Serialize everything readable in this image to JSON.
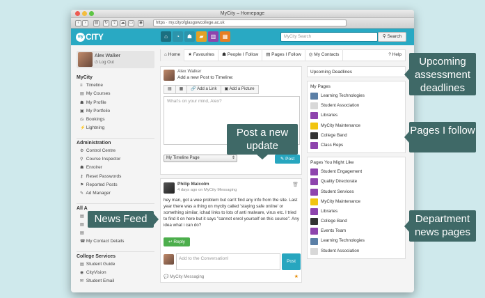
{
  "browser": {
    "title": "MyCity – Homepage",
    "url": "https · my.cityofglasgowcollege.ac.uk"
  },
  "nav": {
    "logo_prefix": "my",
    "logo_text": "CITY",
    "search_placeholder": "MyCity Search",
    "search_button": "Search",
    "icons": [
      {
        "name": "home-icon",
        "glyph": "⌂",
        "color": "#1b6f80"
      },
      {
        "name": "dashboard-icon",
        "glyph": "◔",
        "color": "#2c94ab"
      },
      {
        "name": "users-icon",
        "glyph": "☗",
        "color": "#2c94ab"
      },
      {
        "name": "folder-icon",
        "glyph": "▰",
        "color": "#e4a124"
      },
      {
        "name": "chart-icon",
        "glyph": "▥",
        "color": "#8e44ad"
      },
      {
        "name": "calendar-icon",
        "glyph": "▦",
        "color": "#e67e22"
      }
    ]
  },
  "user": {
    "name": "Alex Walker",
    "logout": "Log Out"
  },
  "sidebar": {
    "sections": [
      {
        "title": "MyCity",
        "items": [
          {
            "label": "Timeline",
            "icon": "≡"
          },
          {
            "label": "My Courses",
            "icon": "▤"
          },
          {
            "label": "My Profile",
            "icon": "☗"
          },
          {
            "label": "My Portfolio",
            "icon": "▣"
          },
          {
            "label": "Bookings",
            "icon": "◷"
          },
          {
            "label": "Lightning",
            "icon": "⚡"
          }
        ]
      },
      {
        "title": "Administration",
        "items": [
          {
            "label": "Control Centre",
            "icon": "⚙"
          },
          {
            "label": "Course Inspector",
            "icon": "⚲"
          },
          {
            "label": "Enrolrer",
            "icon": "☗"
          },
          {
            "label": "Reset Passwords",
            "icon": "⚷"
          },
          {
            "label": "Reported Posts",
            "icon": "⚑"
          },
          {
            "label": "Ad Manager",
            "icon": "✎"
          }
        ]
      },
      {
        "title": "All A",
        "items": [
          {
            "label": "",
            "icon": "▤"
          },
          {
            "label": "",
            "icon": "▤"
          },
          {
            "label": "",
            "icon": "▤"
          },
          {
            "label": "My Contact Details",
            "icon": "☎"
          }
        ]
      },
      {
        "title": "College Services",
        "items": [
          {
            "label": "Student Guide",
            "icon": "▤"
          },
          {
            "label": "CityVision",
            "icon": "◉"
          },
          {
            "label": "Student Email",
            "icon": "✉"
          }
        ]
      }
    ]
  },
  "tabs": [
    {
      "label": "Home",
      "icon": "⌂"
    },
    {
      "label": "Favourites",
      "icon": "★"
    },
    {
      "label": "People I Follow",
      "icon": "☗"
    },
    {
      "label": "Pages I Follow",
      "icon": "▤"
    },
    {
      "label": "My Contacts",
      "icon": "◎"
    },
    {
      "label": "Help",
      "icon": "?"
    }
  ],
  "post_form": {
    "author": "Alex Walker",
    "prompt": "Add a new Post to Timeline:",
    "add_link": "Add a Link",
    "add_picture": "Add a Picture",
    "placeholder": "What's on your mind, Alex?",
    "target": "My Timeline Page",
    "post_button": "Post"
  },
  "feed_post": {
    "author": "Philip Malcolm",
    "meta": "4 days ago on MyCity Messaging",
    "body": "hey man, got a wee problem but can't find any info from the site. Last year there was a thing on mycity called 'staying safe online' or something similar, ichad links to lots of anti malware, virus etc. I tried to find it on here but it says \"cannot enrol yourself on this course\". Any idea what i can do?",
    "reply": "Reply",
    "comment_placeholder": "Add to the Conversation!",
    "comment_post": "Post",
    "source": "MyCity Messaging"
  },
  "right": {
    "deadlines_title": "Upcoming Deadlines",
    "my_pages_title": "My Pages",
    "my_pages": [
      {
        "label": "Learning Technologies",
        "color": "#5b7fa6"
      },
      {
        "label": "Student Association",
        "color": "#d8d8d8"
      },
      {
        "label": "Libraries",
        "color": "#8e44ad"
      },
      {
        "label": "MyCity Maintenance",
        "color": "#f1c40f"
      },
      {
        "label": "College Band",
        "color": "#333333"
      },
      {
        "label": "Class Reps",
        "color": "#8e44ad"
      }
    ],
    "suggest_title": "Pages You Might Like",
    "suggest_pages": [
      {
        "label": "Student Engagement",
        "color": "#8e44ad"
      },
      {
        "label": "Quality Directorate",
        "color": "#8e44ad"
      },
      {
        "label": "Student Services",
        "color": "#8e44ad"
      },
      {
        "label": "MyCity Maintenance",
        "color": "#f1c40f"
      },
      {
        "label": "Libraries",
        "color": "#8e44ad"
      },
      {
        "label": "College Band",
        "color": "#333333"
      },
      {
        "label": "Events Team",
        "color": "#8e44ad"
      },
      {
        "label": "Learning Technologies",
        "color": "#5b7fa6"
      },
      {
        "label": "Student Association",
        "color": "#d8d8d8"
      }
    ]
  },
  "callouts": {
    "deadlines": "Upcoming assessment deadlines",
    "post": "Post a new update",
    "follow": "Pages I follow",
    "news": "News Feed",
    "dept": "Department news pages"
  }
}
